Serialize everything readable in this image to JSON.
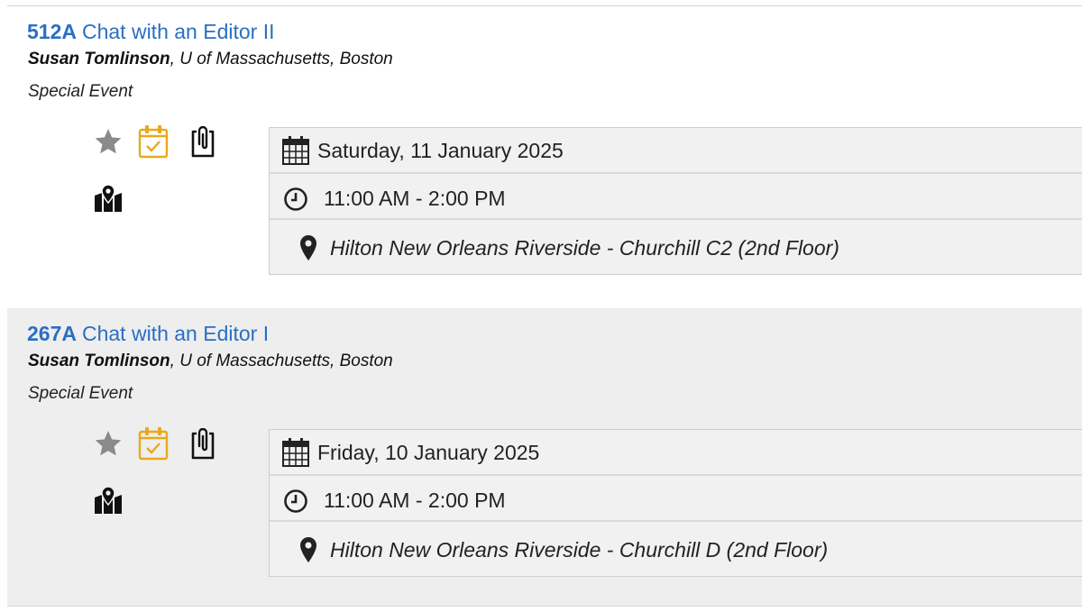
{
  "sessions": [
    {
      "code": "512A",
      "title": "Chat with an Editor II",
      "speaker_name": "Susan Tomlinson",
      "speaker_affiliation": ", U of Massachusetts, Boston",
      "type": "Special Event",
      "date": "Saturday, 11 January 2025",
      "time": "11:00 AM - 2:00 PM",
      "location": "Hilton New Orleans Riverside - Churchill C2 (2nd Floor)"
    },
    {
      "code": "267A",
      "title": "Chat with an Editor I",
      "speaker_name": "Susan Tomlinson",
      "speaker_affiliation": ", U of Massachusetts, Boston",
      "type": "Special Event",
      "date": "Friday, 10 January 2025",
      "time": "11:00 AM - 2:00 PM",
      "location": "Hilton New Orleans Riverside - Churchill D (2nd Floor)"
    }
  ],
  "icons": {
    "favorite": "star-icon",
    "add_to_calendar": "calendar-check-icon",
    "attachment": "clipboard-attachment-icon",
    "map": "map-marker-icon",
    "date": "calendar-icon",
    "time": "clock-icon",
    "location": "location-pin-icon"
  },
  "colors": {
    "link": "#2a6fc2",
    "calendar_accent": "#e8a91a",
    "star": "#8a8a8a",
    "alt_row_bg": "#eeeeee"
  }
}
